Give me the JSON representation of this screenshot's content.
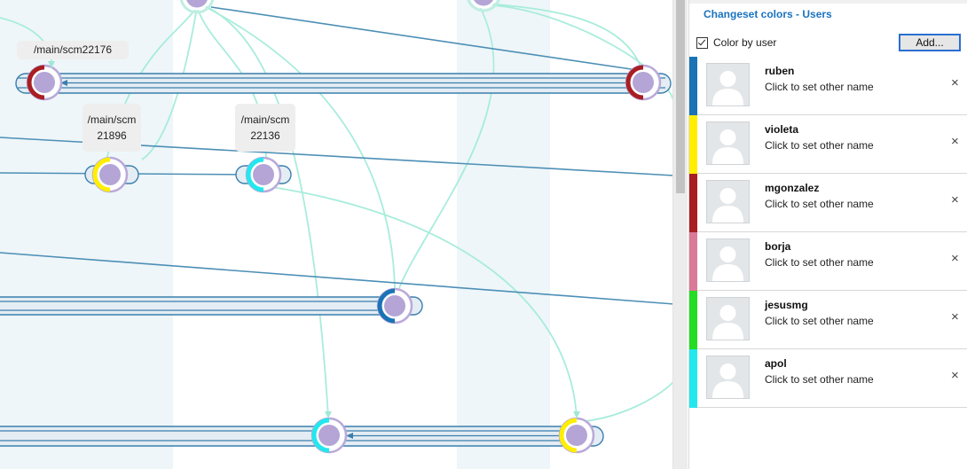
{
  "graph": {
    "branch_labels": [
      "/main/scm22176",
      "/main/scm",
      "21896",
      "/main/scm",
      "22136"
    ]
  },
  "panel": {
    "title": "Changeset colors - Users",
    "color_by_user_label": "Color by user",
    "color_by_user_checked": true,
    "add_button_label": "Add...",
    "users": [
      {
        "name": "ruben",
        "subtitle": "Click to set other name",
        "color": "#1a73b5"
      },
      {
        "name": "violeta",
        "subtitle": "Click to set other name",
        "color": "#ffee00"
      },
      {
        "name": "mgonzalez",
        "subtitle": "Click to set other name",
        "color": "#a81e23"
      },
      {
        "name": "borja",
        "subtitle": "Click to set other name",
        "color": "#d97a98"
      },
      {
        "name": "jesusmg",
        "subtitle": "Click to set other name",
        "color": "#22dd22"
      },
      {
        "name": "apol",
        "subtitle": "Click to set other name",
        "color": "#22e8ee"
      }
    ],
    "remove_glyph": "×"
  },
  "colors": {
    "node_fill": "#b4a5d6",
    "node_ring": "#b9a9d9",
    "branch_line": "#3a7fae",
    "merge_line": "#9fe8d6",
    "column_shade": "#eef6f9"
  }
}
